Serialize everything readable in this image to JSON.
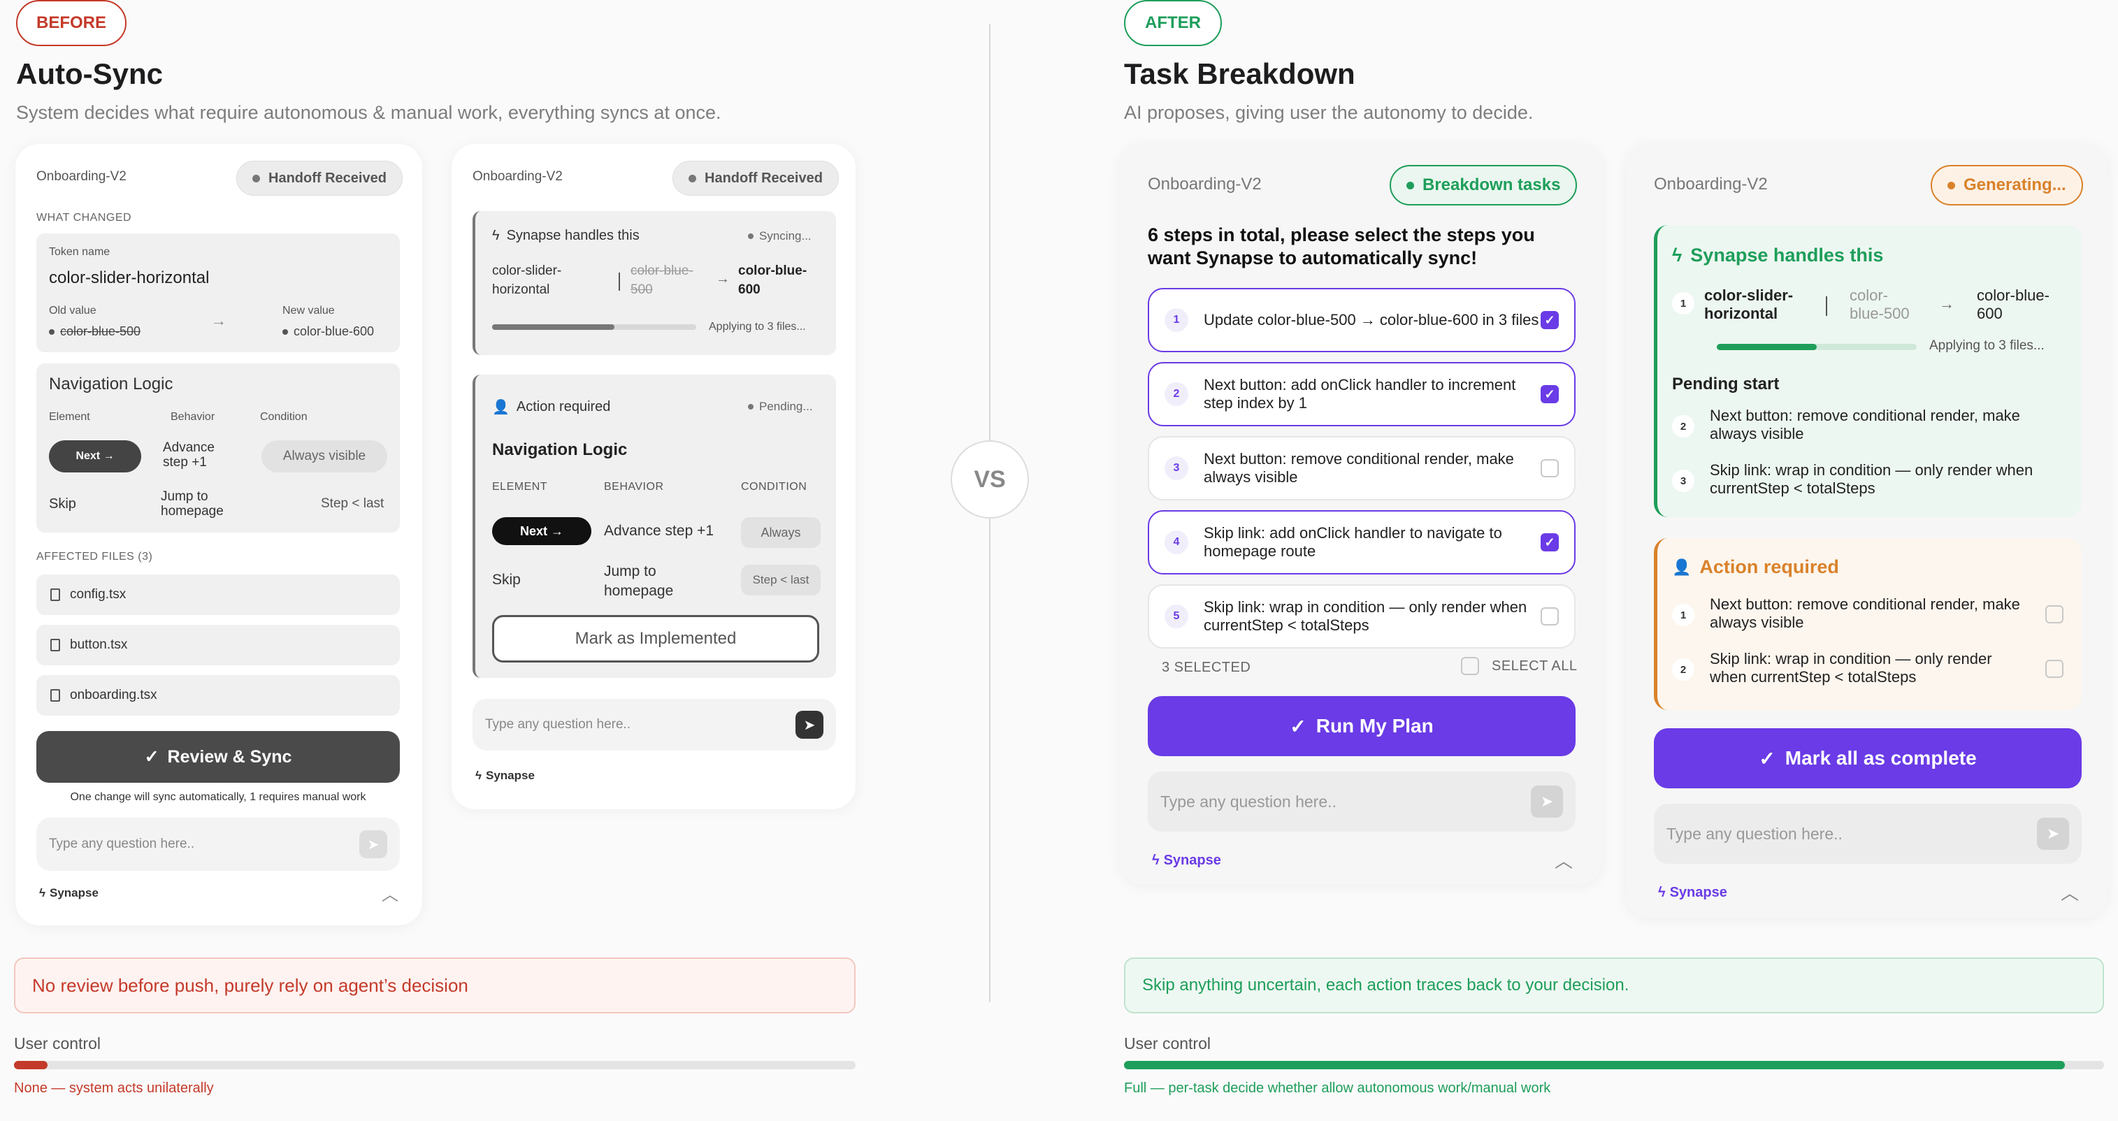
{
  "vs_label": "VS",
  "before": {
    "tag": "BEFORE",
    "title": "Auto-Sync",
    "subtitle": "System decides what require autonomous & manual work, everything syncs at once.",
    "panel1": {
      "project": "Onboarding-V2",
      "status": "Handoff Received",
      "what_changed": "WHAT CHANGED",
      "token_label": "Token name",
      "token_name": "color-slider-horizontal",
      "old_label": "Old value",
      "old_value": "color-blue-500",
      "new_label": "New value",
      "new_value": "color-blue-600",
      "nav_title": "Navigation Logic",
      "col_element": "Element",
      "col_behavior": "Behavior",
      "col_condition": "Condition",
      "row1_element": "Next →",
      "row1_behavior": "Advance step +1",
      "row1_condition": "Always visible",
      "row2_element": "Skip",
      "row2_behavior": "Jump to homepage",
      "row2_condition": "Step < last",
      "affected": "AFFECTED FILES (3)",
      "files": [
        "config.tsx",
        "button.tsx",
        "onboarding.tsx"
      ],
      "cta": "Review & Sync",
      "note": "One change will sync automatically, 1 requires manual work",
      "placeholder": "Type any question here..",
      "brand": "Synapse"
    },
    "panel2": {
      "project": "Onboarding-V2",
      "status": "Handoff Received",
      "synapse_title": "Synapse handles this",
      "syncing": "Syncing...",
      "token": "color-slider-horizontal",
      "old_value": "color-blue-500",
      "new_value": "color-blue-600",
      "progress": 0.6,
      "applying": "Applying to 3 files...",
      "action_title": "Action required",
      "pending": "Pending...",
      "nav_title": "Navigation Logic",
      "col_element": "ELEMENT",
      "col_behavior": "BEHAVIOR",
      "col_condition": "CONDITION",
      "row1_element": "Next →",
      "row1_behavior": "Advance step +1",
      "row1_condition": "Always",
      "row2_element": "Skip",
      "row2_behavior": "Jump to homepage",
      "row2_condition": "Step < last",
      "cta": "Mark as Implemented",
      "placeholder": "Type any question here..",
      "brand": "Synapse"
    },
    "callout": "No review before push, purely rely on agent’s decision",
    "control_label": "User control",
    "control_value": 0.04,
    "control_caption": "None — system acts unilaterally"
  },
  "after": {
    "tag": "AFTER",
    "title": "Task Breakdown",
    "subtitle": "AI proposes, giving user the autonomy to decide.",
    "panel1": {
      "project": "Onboarding-V2",
      "status": "Breakdown tasks",
      "heading": "6 steps in total, please select the steps you want Synapse to automatically sync!",
      "steps": [
        {
          "n": "1",
          "text": "Update color-blue-500 → color-blue-600 in 3 files",
          "checked": true
        },
        {
          "n": "2",
          "text": "Next button: add onClick handler to increment step index by 1",
          "checked": true
        },
        {
          "n": "3",
          "text": "Next button: remove conditional render, make always visible",
          "checked": false
        },
        {
          "n": "4",
          "text": "Skip link: add onClick handler to navigate to homepage route",
          "checked": true
        },
        {
          "n": "5",
          "text": "Skip link: wrap in condition — only render when currentStep < totalSteps",
          "checked": false
        }
      ],
      "selected": "3 SELECTED",
      "select_all": "SELECT ALL",
      "cta": "Run My Plan",
      "placeholder": "Type any question here..",
      "brand": "Synapse"
    },
    "panel2": {
      "project": "Onboarding-V2",
      "status": "Generating...",
      "synapse_title": "Synapse handles this",
      "row_n": "1",
      "token": "color-slider-horizontal",
      "old_value": "color-blue-500",
      "new_value": "color-blue-600",
      "progress": 0.5,
      "applying": "Applying to 3 files...",
      "pending_title": "Pending start",
      "pending": [
        {
          "n": "2",
          "text": "Next button: remove conditional render, make always visible"
        },
        {
          "n": "3",
          "text": "Skip link: wrap in condition — only render when currentStep < totalSteps"
        }
      ],
      "action_title": "Action required",
      "actions": [
        {
          "n": "1",
          "text": "Next button: remove conditional render, make always visible"
        },
        {
          "n": "2",
          "text": "Skip link: wrap in condition — only render when currentStep < totalSteps"
        }
      ],
      "cta": "Mark all as complete",
      "placeholder": "Type any question here..",
      "brand": "Synapse"
    },
    "callout": "Skip anything uncertain, each action traces back to your decision.",
    "control_label": "User control",
    "control_value": 0.96,
    "control_caption": "Full — per-task decide whether allow autonomous work/manual work"
  },
  "colors": {
    "red": "#c43a2a",
    "green": "#1e9e5a",
    "purple": "#6a3be6",
    "orange": "#d9822b"
  }
}
